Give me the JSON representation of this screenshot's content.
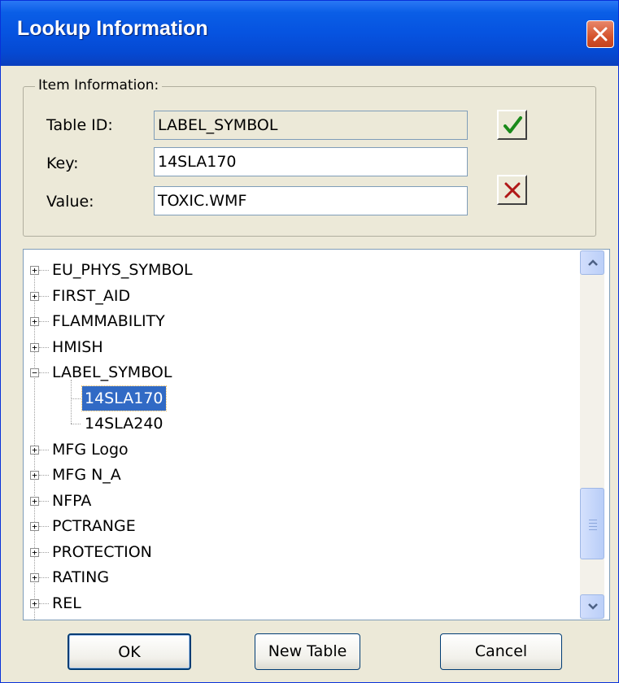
{
  "window": {
    "title": "Lookup Information"
  },
  "item_info": {
    "legend": "Item Information:",
    "table_id_label": "Table ID:",
    "table_id_value": "LABEL_SYMBOL",
    "key_label": "Key:",
    "key_value": "14SLA170",
    "value_label": "Value:",
    "value_value": "TOXIC.WMF"
  },
  "tree": {
    "items": [
      {
        "label": "EU_PHYS_SYMBOL",
        "expander": "+"
      },
      {
        "label": "FIRST_AID",
        "expander": "+"
      },
      {
        "label": "FLAMMABILITY",
        "expander": "+"
      },
      {
        "label": "HMISH",
        "expander": "+"
      },
      {
        "label": "LABEL_SYMBOL",
        "expander": "−"
      },
      {
        "label": "14SLA170",
        "selected": true
      },
      {
        "label": "14SLA240"
      },
      {
        "label": "MFG Logo",
        "expander": "+"
      },
      {
        "label": "MFG N_A",
        "expander": "+"
      },
      {
        "label": "NFPA",
        "expander": "+"
      },
      {
        "label": "PCTRANGE",
        "expander": "+"
      },
      {
        "label": "PROTECTION",
        "expander": "+"
      },
      {
        "label": "RATING",
        "expander": "+"
      },
      {
        "label": "REL",
        "expander": "+"
      }
    ]
  },
  "buttons": {
    "ok": "OK",
    "new_table": "New Table",
    "cancel": "Cancel"
  },
  "icons": {
    "confirm": "checkmark-icon",
    "delete": "x-icon",
    "close": "close-icon",
    "scroll_up": "chevron-up-icon",
    "scroll_down": "chevron-down-icon"
  },
  "colors": {
    "titlebar": "#0653e0",
    "selection": "#316ac5",
    "dialog_bg": "#ece9d8",
    "checkmark": "#1a8a1a",
    "x_mark": "#b01818"
  }
}
